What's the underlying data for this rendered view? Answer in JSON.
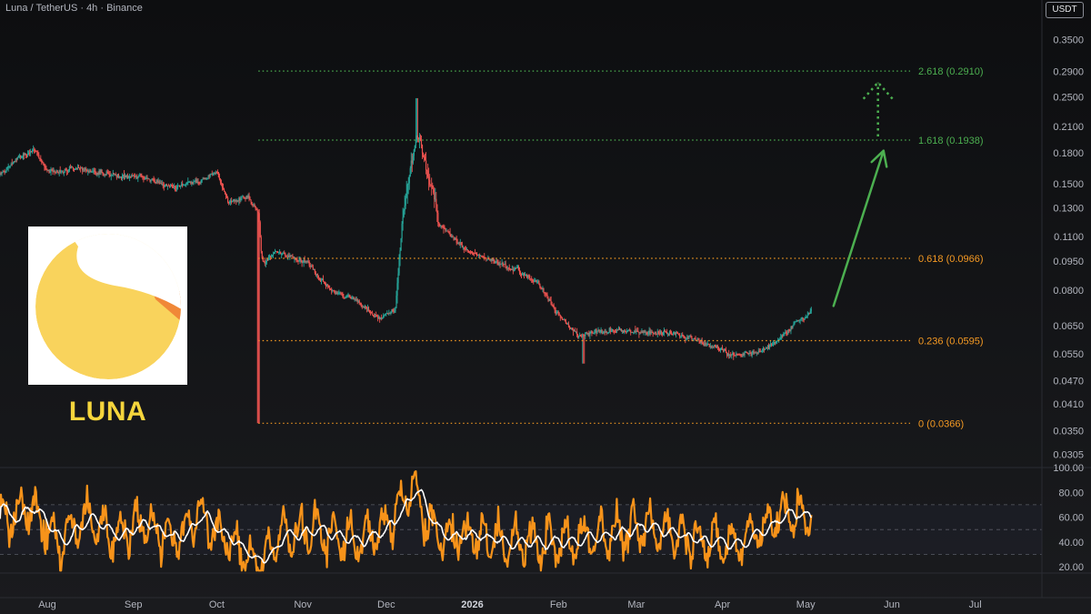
{
  "header": {
    "symbol_title": "Luna / TetherUS · 4h · Binance",
    "currency_badge": "USDT"
  },
  "overlay": {
    "coin_label": "LUNA",
    "logo_colors": {
      "background": "#ffffff",
      "coin": "#f9d35c",
      "wedge": "#f08838"
    }
  },
  "colors": {
    "background": "#111214",
    "candle_up": "#26a69a",
    "candle_down": "#ef5350",
    "fib_upper": "#4caf50",
    "fib_lower": "#f59a23",
    "arrow": "#4caf50",
    "rsi_line": "#f7931a",
    "rsi_ma": "#ffffff",
    "axis_text": "#b2b5be"
  },
  "chart_data": [
    {
      "type": "candlestick",
      "scale": "log",
      "xaxis": {
        "ticks": [
          "Aug",
          "Sep",
          "Oct",
          "Nov",
          "Dec",
          "2026",
          "Feb",
          "Mar",
          "Apr",
          "May",
          "Jun",
          "Jul"
        ],
        "range": [
          "2025-07-15",
          "2026-07-25"
        ]
      },
      "yaxis": {
        "ticks": [
          "0.3500",
          "0.2900",
          "0.2500",
          "0.2100",
          "0.1800",
          "0.1500",
          "0.1300",
          "0.1100",
          "0.0950",
          "0.0800",
          "0.0650",
          "0.0550",
          "0.0470",
          "0.0410",
          "0.0350",
          "0.0305"
        ],
        "ylim": [
          0.0282,
          0.442
        ]
      },
      "price_path": [
        {
          "t": "2025-07-15",
          "p": 0.158
        },
        {
          "t": "2025-07-20",
          "p": 0.172
        },
        {
          "t": "2025-07-27",
          "p": 0.183
        },
        {
          "t": "2025-08-01",
          "p": 0.16
        },
        {
          "t": "2025-08-12",
          "p": 0.164
        },
        {
          "t": "2025-08-25",
          "p": 0.158
        },
        {
          "t": "2025-09-05",
          "p": 0.155
        },
        {
          "t": "2025-09-15",
          "p": 0.147
        },
        {
          "t": "2025-09-25",
          "p": 0.152
        },
        {
          "t": "2025-10-01",
          "p": 0.16
        },
        {
          "t": "2025-10-05",
          "p": 0.133
        },
        {
          "t": "2025-10-12",
          "p": 0.14
        },
        {
          "t": "2025-10-16",
          "p": 0.125
        },
        {
          "t": "2025-10-17",
          "p": 0.092
        },
        {
          "t": "2025-10-22",
          "p": 0.1
        },
        {
          "t": "2025-11-01",
          "p": 0.096
        },
        {
          "t": "2025-11-10",
          "p": 0.081
        },
        {
          "t": "2025-11-20",
          "p": 0.075
        },
        {
          "t": "2025-11-28",
          "p": 0.068
        },
        {
          "t": "2025-12-04",
          "p": 0.072
        },
        {
          "t": "2025-12-07",
          "p": 0.13
        },
        {
          "t": "2025-12-12",
          "p": 0.205
        },
        {
          "t": "2025-12-16",
          "p": 0.158
        },
        {
          "t": "2025-12-20",
          "p": 0.118
        },
        {
          "t": "2025-12-28",
          "p": 0.103
        },
        {
          "t": "2026-01-05",
          "p": 0.097
        },
        {
          "t": "2026-01-15",
          "p": 0.092
        },
        {
          "t": "2026-01-25",
          "p": 0.083
        },
        {
          "t": "2026-02-01",
          "p": 0.069
        },
        {
          "t": "2026-02-08",
          "p": 0.061
        },
        {
          "t": "2026-02-15",
          "p": 0.063
        },
        {
          "t": "2026-03-01",
          "p": 0.063
        },
        {
          "t": "2026-03-15",
          "p": 0.062
        },
        {
          "t": "2026-03-25",
          "p": 0.059
        },
        {
          "t": "2026-04-05",
          "p": 0.0545
        },
        {
          "t": "2026-04-15",
          "p": 0.056
        },
        {
          "t": "2026-04-20",
          "p": 0.059
        },
        {
          "t": "2026-04-25",
          "p": 0.064
        },
        {
          "t": "2026-05-03",
          "p": 0.071
        }
      ],
      "fib_levels": [
        {
          "label": "2.618 (0.2910)",
          "value": 0.291,
          "color": "#4caf50"
        },
        {
          "label": "1.618 (0.1938)",
          "value": 0.1938,
          "color": "#4caf50"
        },
        {
          "label": "0.618 (0.0966)",
          "value": 0.0966,
          "color": "#f59a23"
        },
        {
          "label": "0.236 (0.0595)",
          "value": 0.0595,
          "color": "#f59a23"
        },
        {
          "label": "0 (0.0366)",
          "value": 0.0366,
          "color": "#f59a23"
        }
      ],
      "fib_start": "2025-10-16",
      "projection_arrow": {
        "from": {
          "t": "2026-05-11",
          "p": 0.073
        },
        "to": {
          "t": "2026-05-29",
          "p": 0.182
        }
      },
      "projection_dotted": {
        "from": {
          "t": "2026-05-27",
          "p": 0.198
        },
        "to": {
          "t": "2026-05-27",
          "p": 0.272
        }
      }
    },
    {
      "type": "line",
      "name": "RSI",
      "yaxis": {
        "ticks": [
          "100.00",
          "80.00",
          "60.00",
          "40.00",
          "20.00"
        ],
        "ylim": [
          15,
          100
        ]
      },
      "bands": [
        70,
        50,
        30
      ],
      "series_path": [
        {
          "t": "2025-07-15",
          "v": 55
        },
        {
          "t": "2025-07-25",
          "v": 72
        },
        {
          "t": "2025-08-05",
          "v": 38
        },
        {
          "t": "2025-08-15",
          "v": 60
        },
        {
          "t": "2025-08-25",
          "v": 45
        },
        {
          "t": "2025-09-05",
          "v": 58
        },
        {
          "t": "2025-09-15",
          "v": 42
        },
        {
          "t": "2025-09-25",
          "v": 62
        },
        {
          "t": "2025-10-05",
          "v": 40
        },
        {
          "t": "2025-10-17",
          "v": 22
        },
        {
          "t": "2025-10-25",
          "v": 48
        },
        {
          "t": "2025-11-05",
          "v": 50
        },
        {
          "t": "2025-11-15",
          "v": 42
        },
        {
          "t": "2025-11-28",
          "v": 45
        },
        {
          "t": "2025-12-10",
          "v": 82
        },
        {
          "t": "2025-12-20",
          "v": 42
        },
        {
          "t": "2026-01-01",
          "v": 45
        },
        {
          "t": "2026-01-15",
          "v": 40
        },
        {
          "t": "2026-02-01",
          "v": 38
        },
        {
          "t": "2026-02-15",
          "v": 46
        },
        {
          "t": "2026-03-01",
          "v": 50
        },
        {
          "t": "2026-03-15",
          "v": 48
        },
        {
          "t": "2026-04-01",
          "v": 38
        },
        {
          "t": "2026-04-10",
          "v": 42
        },
        {
          "t": "2026-04-20",
          "v": 60
        },
        {
          "t": "2026-05-03",
          "v": 62
        }
      ]
    }
  ]
}
